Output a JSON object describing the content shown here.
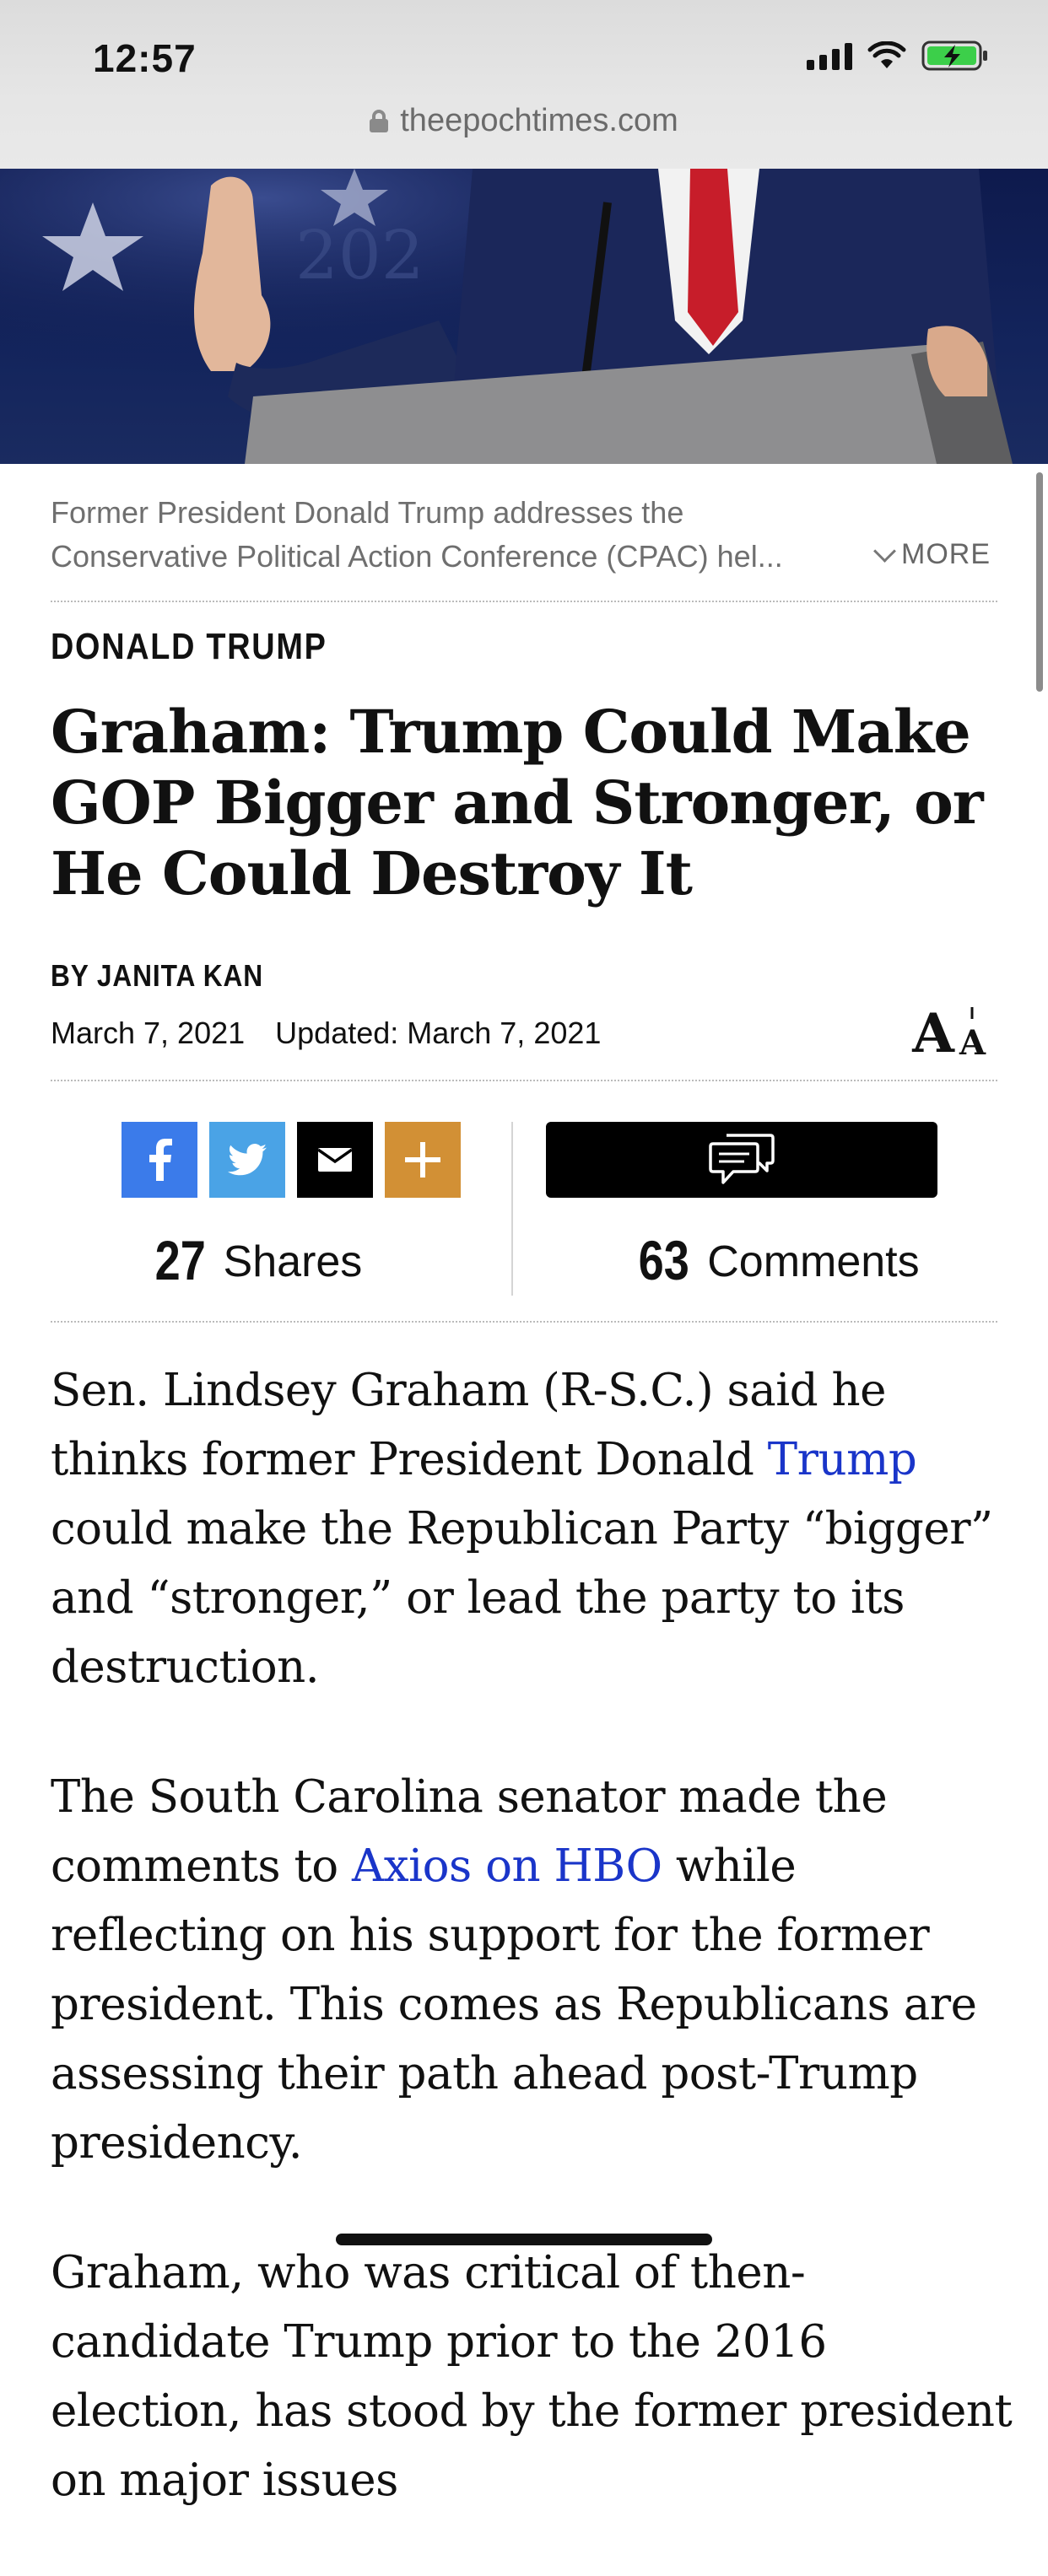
{
  "status_bar": {
    "time": "12:57"
  },
  "browser": {
    "url": "theepochtimes.com"
  },
  "hero": {
    "caption_line1": "Former President Donald Trump addresses the",
    "caption_line2": "Conservative Political Action Conference (CPAC) hel...",
    "more_label": "MORE"
  },
  "article": {
    "section": "DONALD TRUMP",
    "headline": "Graham: Trump Could Make GOP Bigger and Stronger, or He Could Destroy It",
    "byline_prefix": "BY",
    "author": "JANITA KAN",
    "published": "March 7, 2021",
    "updated": "Updated: March 7, 2021"
  },
  "share": {
    "shares_count": "27",
    "shares_label": "Shares",
    "comments_count": "63",
    "comments_label": "Comments"
  },
  "body": {
    "p1_before": "Sen. Lindsey Graham (R-S.C.) said he thinks former President Donald ",
    "p1_link": "Trump",
    "p1_after": " could make the Republican Party “bigger” and “stronger,” or lead the party to its destruction.",
    "p2_before": "The South Carolina senator made the comments to ",
    "p2_link": "Axios on HBO",
    "p2_after": " while reflecting on his support for the former president. This comes as Republicans are assessing their path ahead post-Trump presidency.",
    "p3": "Graham, who was critical of then-candidate Trump prior to the 2016 election, has stood by the former president on major issues"
  },
  "colors": {
    "facebook": "#3b7bea",
    "twitter": "#4aa3e6",
    "email": "#000000",
    "more_share": "#d29035",
    "link": "#1a35c9"
  }
}
